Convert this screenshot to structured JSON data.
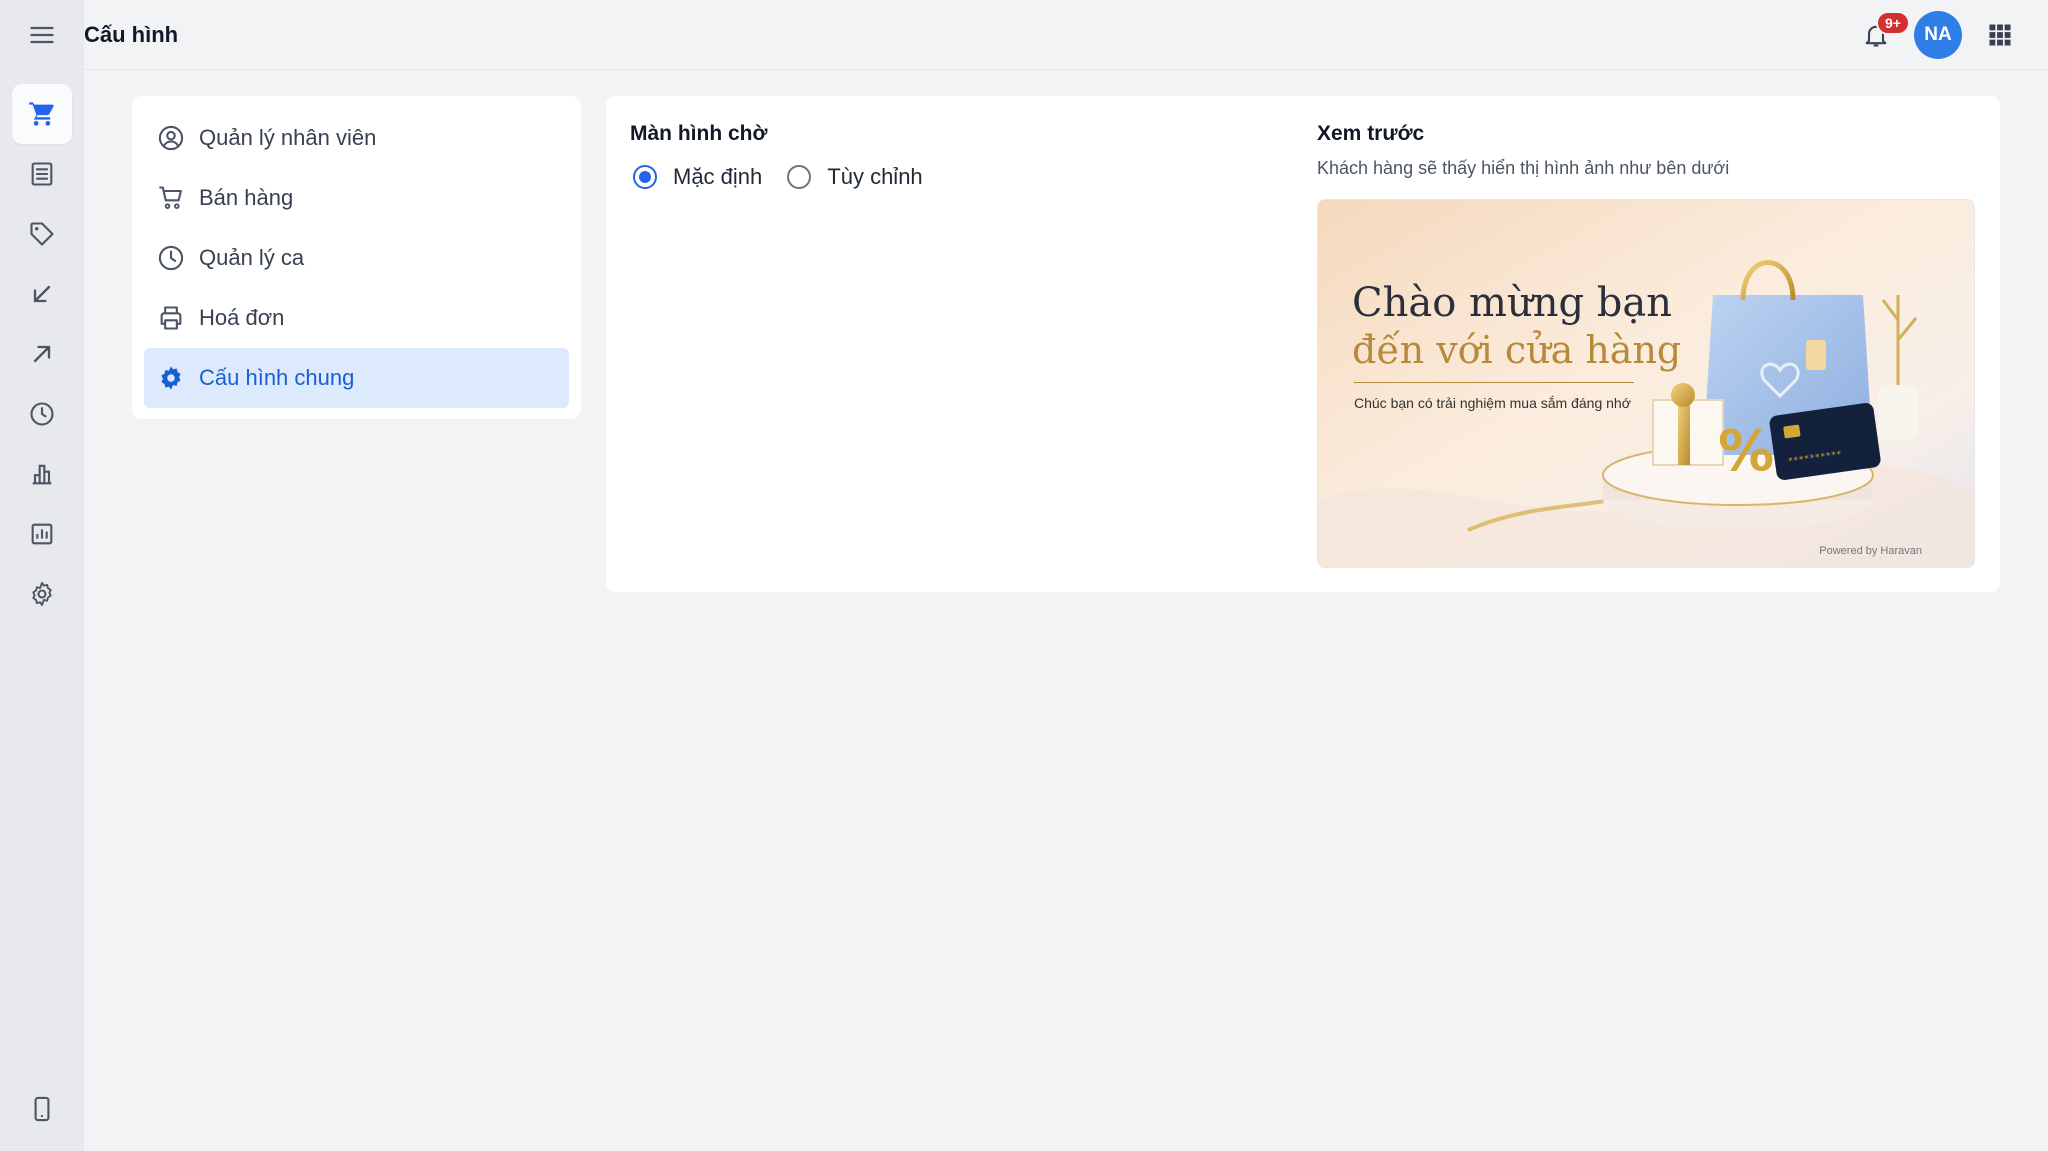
{
  "header": {
    "title": "Cấu hình",
    "notification_badge": "9+",
    "avatar_initials": "NA"
  },
  "rail": {
    "items": [
      {
        "icon": "cart-icon",
        "active": true
      },
      {
        "icon": "list-icon"
      },
      {
        "icon": "tag-icon"
      },
      {
        "icon": "arrow-down-left-icon"
      },
      {
        "icon": "arrow-up-right-icon"
      },
      {
        "icon": "clock-icon"
      },
      {
        "icon": "bar-chart-icon"
      },
      {
        "icon": "report-icon"
      },
      {
        "icon": "gear-icon"
      }
    ],
    "bottom_icon": "mobile-icon"
  },
  "settings_menu": {
    "items": [
      {
        "label": "Quản lý nhân viên",
        "icon": "user-circle-icon"
      },
      {
        "label": "Bán hàng",
        "icon": "cart-icon"
      },
      {
        "label": "Quản lý ca",
        "icon": "clock-icon"
      },
      {
        "label": "Hoá đơn",
        "icon": "printer-icon"
      },
      {
        "label": "Cấu hình chung",
        "icon": "gear-icon",
        "active": true
      }
    ]
  },
  "screen": {
    "title": "Màn hình chờ",
    "options": [
      {
        "label": "Mặc định",
        "checked": true
      },
      {
        "label": "Tùy chỉnh",
        "checked": false
      }
    ]
  },
  "preview": {
    "title": "Xem trước",
    "description": "Khách hàng sẽ thấy hiển thị hình ảnh như bên dưới",
    "image": {
      "line1": "Chào mừng bạn",
      "line2": "đến với cửa hàng",
      "subtitle": "Chúc bạn có trải nghiệm mua sắm đáng nhớ",
      "powered": "Powered by Haravan"
    }
  },
  "colors": {
    "accent": "#2563eb",
    "active_bg": "#ddeafd",
    "badge": "#d32f2f",
    "avatar": "#2f7ee8"
  }
}
